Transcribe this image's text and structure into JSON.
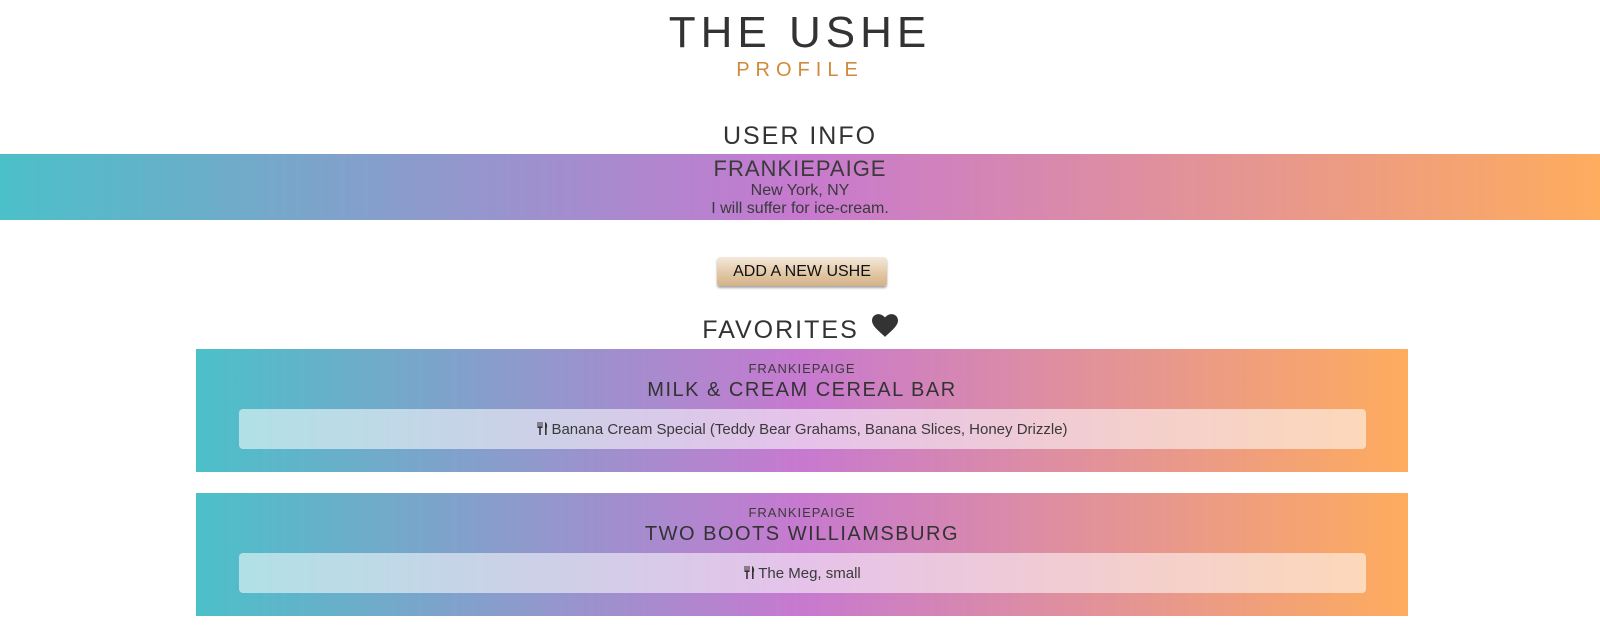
{
  "header": {
    "title": "THE USHE",
    "subtitle": "PROFILE",
    "accent_color": "#d08a3a"
  },
  "user_info": {
    "heading": "USER INFO",
    "username": "FRANKIEPAIGE",
    "location": "New York, NY",
    "bio": "I will suffer for ice-cream."
  },
  "actions": {
    "add_label": "ADD A NEW USHE"
  },
  "favorites": {
    "heading": "FAVORITES",
    "heading_icon": "heart-icon",
    "items": [
      {
        "user": "FRANKIEPAIGE",
        "place": "MILK & CREAM CEREAL BAR",
        "item": "Banana Cream Special (Teddy Bear Grahams, Banana Slices, Honey Drizzle)",
        "item_icon": "utensils-icon"
      },
      {
        "user": "FRANKIEPAIGE",
        "place": "TWO BOOTS WILLIAMSBURG",
        "item": "The Meg, small",
        "item_icon": "utensils-icon"
      }
    ]
  },
  "colors": {
    "gradient_start": "#4bc0c8",
    "gradient_mid": "#c779d0",
    "gradient_end": "#feac5e"
  }
}
